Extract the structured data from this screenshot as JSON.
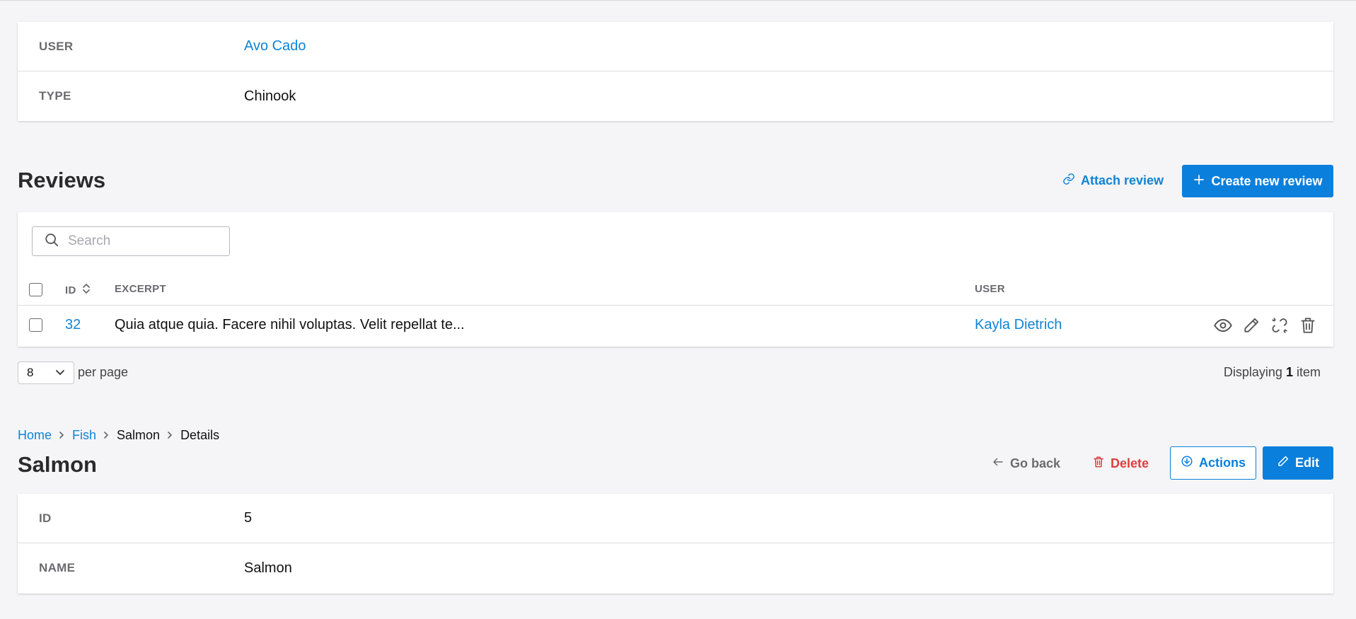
{
  "top_details": {
    "rows": [
      {
        "label": "USER",
        "value": "Avo Cado"
      },
      {
        "label": "TYPE",
        "value": "Chinook"
      }
    ]
  },
  "reviews": {
    "title": "Reviews",
    "attach_label": "Attach review",
    "create_label": "Create new review",
    "search_placeholder": "Search",
    "columns": {
      "id": "ID",
      "excerpt": "EXCERPT",
      "user": "USER"
    },
    "rows": [
      {
        "id": "32",
        "excerpt": "Quia atque quia. Facere nihil voluptas. Velit repellat te...",
        "user": "Kayla Dietrich"
      }
    ],
    "per_page_value": "8",
    "per_page_label": "per page",
    "displaying_prefix": "Displaying",
    "displaying_count": "1",
    "displaying_suffix": "item"
  },
  "breadcrumb": {
    "items": [
      "Home",
      "Fish",
      "Salmon",
      "Details"
    ]
  },
  "page": {
    "title": "Salmon",
    "go_back_label": "Go back",
    "delete_label": "Delete",
    "actions_label": "Actions",
    "edit_label": "Edit"
  },
  "details": {
    "rows": [
      {
        "label": "ID",
        "value": "5"
      },
      {
        "label": "NAME",
        "value": "Salmon"
      }
    ]
  },
  "colors": {
    "primary": "#0b7fdc",
    "link": "#0f84d6",
    "danger": "#dc3f3f",
    "background": "#f5f5f7"
  },
  "icons": [
    "link-icon",
    "plus-icon",
    "search-icon",
    "sort-icon",
    "eye-icon",
    "pencil-icon",
    "unlink-icon",
    "trash-icon",
    "chevron-down-icon",
    "chevron-right-icon",
    "arrow-left-icon",
    "download-circle-icon"
  ]
}
